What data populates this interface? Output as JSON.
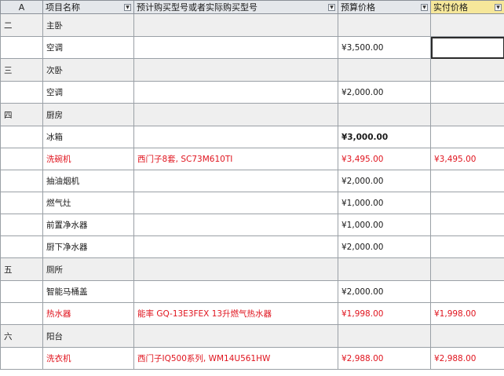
{
  "header": {
    "col_a": "A",
    "col_b": "项目名称",
    "col_c": "预计购买型号或者实际购买型号",
    "col_d": "预算价格",
    "col_e": "实付价格"
  },
  "rows": [
    {
      "type": "section",
      "num": "二",
      "name": "主卧",
      "model": "",
      "budget": "",
      "paid": ""
    },
    {
      "type": "item",
      "num": "",
      "name": "空调",
      "model": "",
      "budget": "¥3,500.00",
      "paid": ""
    },
    {
      "type": "section",
      "num": "三",
      "name": "次卧",
      "model": "",
      "budget": "",
      "paid": ""
    },
    {
      "type": "item",
      "num": "",
      "name": "空调",
      "model": "",
      "budget": "¥2,000.00",
      "paid": ""
    },
    {
      "type": "section",
      "num": "四",
      "name": "厨房",
      "model": "",
      "budget": "",
      "paid": ""
    },
    {
      "type": "item",
      "num": "",
      "name": "冰箱",
      "model": "",
      "budget": "¥3,000.00",
      "paid": "",
      "bold": true
    },
    {
      "type": "item",
      "num": "",
      "name": "洗碗机",
      "model": "西门子8套, SC73M610TI",
      "budget": "¥3,495.00",
      "paid": "¥3,495.00",
      "red": true
    },
    {
      "type": "item",
      "num": "",
      "name": "抽油烟机",
      "model": "",
      "budget": "¥2,000.00",
      "paid": ""
    },
    {
      "type": "item",
      "num": "",
      "name": "燃气灶",
      "model": "",
      "budget": "¥1,000.00",
      "paid": ""
    },
    {
      "type": "item",
      "num": "",
      "name": "前置净水器",
      "model": "",
      "budget": "¥1,000.00",
      "paid": ""
    },
    {
      "type": "item",
      "num": "",
      "name": "厨下净水器",
      "model": "",
      "budget": "¥2,000.00",
      "paid": ""
    },
    {
      "type": "section",
      "num": "五",
      "name": "厕所",
      "model": "",
      "budget": "",
      "paid": ""
    },
    {
      "type": "item",
      "num": "",
      "name": "智能马桶盖",
      "model": "",
      "budget": "¥2,000.00",
      "paid": ""
    },
    {
      "type": "item",
      "num": "",
      "name": "热水器",
      "model": "能率 GQ-13E3FEX 13升燃气热水器",
      "budget": "¥1,998.00",
      "paid": "¥1,998.00",
      "red": true
    },
    {
      "type": "section",
      "num": "六",
      "name": "阳台",
      "model": "",
      "budget": "",
      "paid": ""
    },
    {
      "type": "item",
      "num": "",
      "name": "洗衣机",
      "model": "西门子IQ500系列, WM14U561HW",
      "budget": "¥2,988.00",
      "paid": "¥2,988.00",
      "red": true
    }
  ],
  "colors": {
    "header_bg": "#e4e7eb",
    "header_highlight": "#f6e79a",
    "section_bg": "#efefef",
    "red_text": "#e0141e",
    "grid": "#9aa0a6"
  },
  "icons": {
    "filter": "dropdown-filter-icon"
  }
}
